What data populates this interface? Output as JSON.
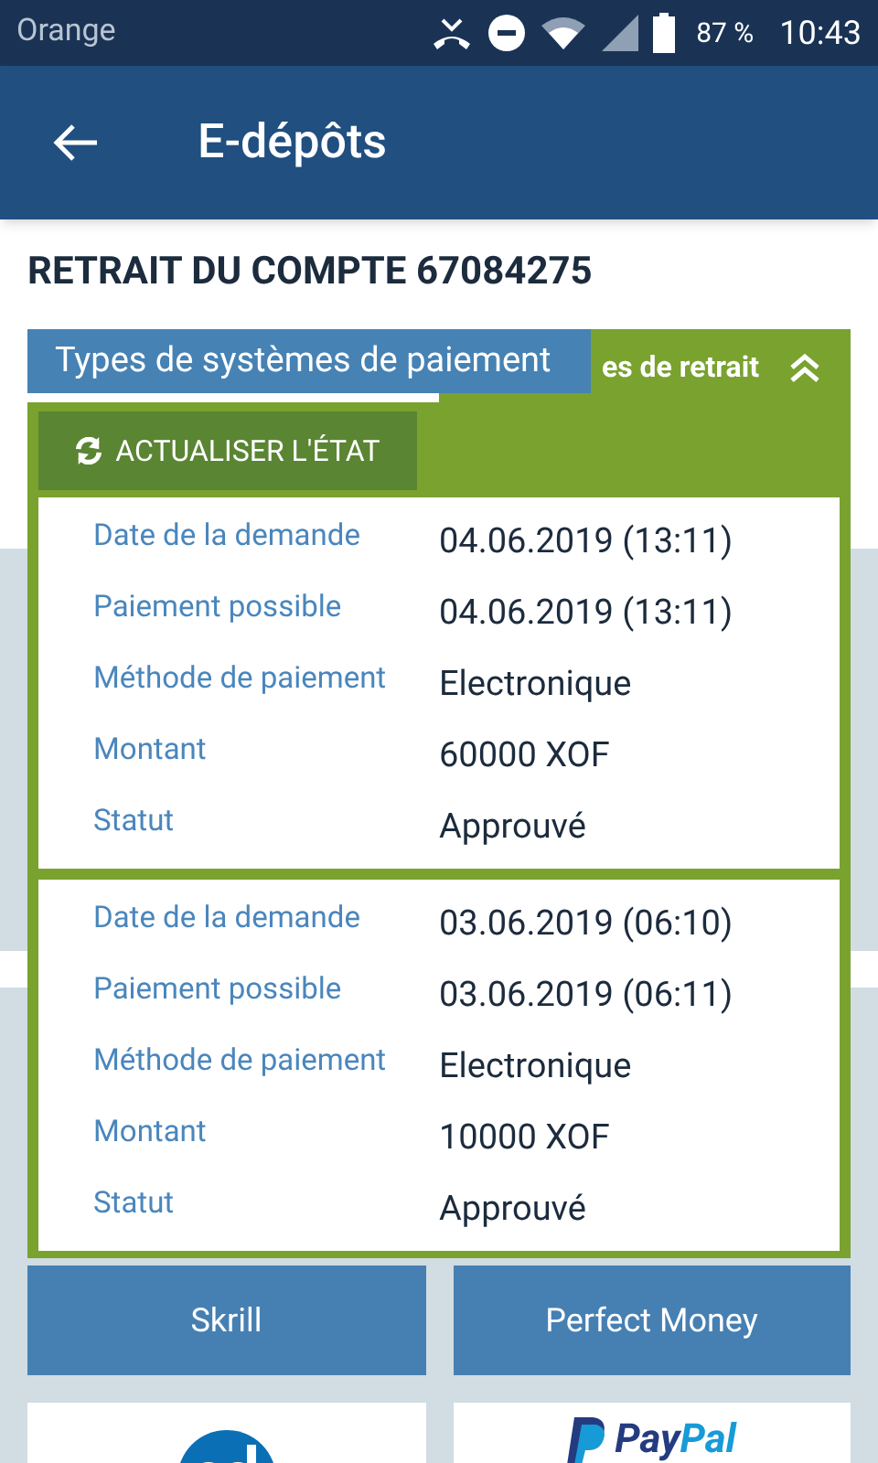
{
  "status_bar": {
    "carrier": "Orange",
    "battery": "87 %",
    "time": "10:43"
  },
  "app_bar": {
    "title": "E-dépôts"
  },
  "page_title": "RETRAIT DU COMPTE 67084275",
  "tab": {
    "label": "Types de systèmes de paiement",
    "selected": true
  },
  "panel": {
    "header": "es de retrait",
    "expanded": true,
    "refresh_button": "ACTUALISER L'ÉTAT",
    "requests": [
      {
        "fields": [
          {
            "label": "Date de la demande",
            "value": "04.06.2019 (13:11)"
          },
          {
            "label": "Paiement possible",
            "value": "04.06.2019 (13:11)"
          },
          {
            "label": "Méthode de paiement",
            "value": "Electronique"
          },
          {
            "label": "Montant",
            "value": "60000 XOF"
          },
          {
            "label": "Statut",
            "value": "Approuvé"
          }
        ]
      },
      {
        "fields": [
          {
            "label": "Date de la demande",
            "value": "03.06.2019 (06:10)"
          },
          {
            "label": "Paiement possible",
            "value": "03.06.2019 (06:11)"
          },
          {
            "label": "Méthode de paiement",
            "value": "Electronique"
          },
          {
            "label": "Montant",
            "value": "10000 XOF"
          },
          {
            "label": "Statut",
            "value": "Approuvé"
          }
        ]
      }
    ]
  },
  "payment_methods": [
    {
      "kind": "button",
      "label": "Skrill"
    },
    {
      "kind": "button",
      "label": "Perfect Money"
    },
    {
      "kind": "pd-logo"
    },
    {
      "kind": "paypal-logo",
      "text_1": "Pay",
      "text_2": "Pal"
    }
  ]
}
